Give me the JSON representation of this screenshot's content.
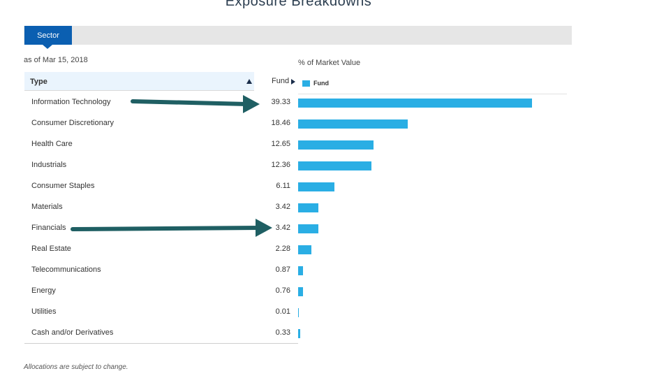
{
  "page": {
    "title": "Exposure Breakdowns"
  },
  "tabs": [
    {
      "label": "Sector",
      "active": true
    }
  ],
  "as_of": "as of Mar 15, 2018",
  "table": {
    "col_type": "Type",
    "col_fund": "Fund",
    "rows": [
      {
        "type": "Information Technology",
        "fund": "39.33"
      },
      {
        "type": "Consumer Discretionary",
        "fund": "18.46"
      },
      {
        "type": "Health Care",
        "fund": "12.65"
      },
      {
        "type": "Industrials",
        "fund": "12.36"
      },
      {
        "type": "Consumer Staples",
        "fund": "6.11"
      },
      {
        "type": "Materials",
        "fund": "3.42"
      },
      {
        "type": "Financials",
        "fund": "3.42"
      },
      {
        "type": "Real Estate",
        "fund": "2.28"
      },
      {
        "type": "Telecommunications",
        "fund": "0.87"
      },
      {
        "type": "Energy",
        "fund": "0.76"
      },
      {
        "type": "Utilities",
        "fund": "0.01"
      },
      {
        "type": "Cash and/or Derivatives",
        "fund": "0.33"
      }
    ]
  },
  "chart_data": {
    "type": "bar",
    "title": "% of Market Value",
    "orientation": "horizontal",
    "categories": [
      "Information Technology",
      "Consumer Discretionary",
      "Health Care",
      "Industrials",
      "Consumer Staples",
      "Materials",
      "Financials",
      "Real Estate",
      "Telecommunications",
      "Energy",
      "Utilities",
      "Cash and/or Derivatives"
    ],
    "series": [
      {
        "name": "Fund",
        "values": [
          39.33,
          18.46,
          12.65,
          12.36,
          6.11,
          3.42,
          3.42,
          2.28,
          0.87,
          0.76,
          0.01,
          0.33
        ]
      }
    ],
    "legend": "top-left",
    "grid": false,
    "bar_color": "#2aaee4"
  },
  "annotations": {
    "arrow_color": "#1f5f63",
    "arrow_targets": [
      "Information Technology",
      "Financials"
    ]
  },
  "footnote": "Allocations are subject to change.",
  "colors": {
    "accent": "#0b5fb1",
    "bar": "#2aaee4",
    "header_bg": "#eaf4fd"
  }
}
